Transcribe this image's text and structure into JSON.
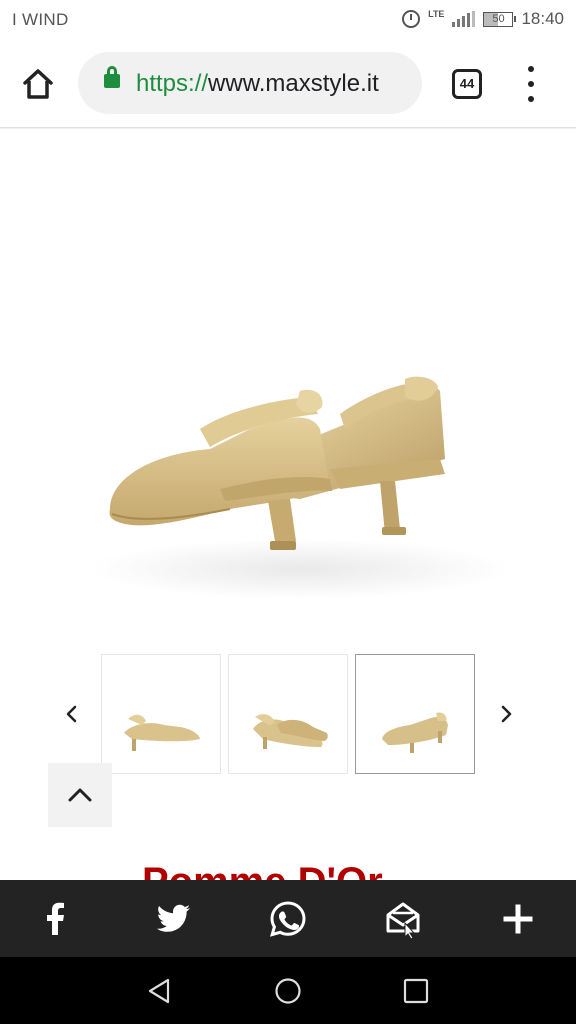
{
  "status_bar": {
    "carrier": "I WIND",
    "network": "LTE",
    "battery": "50",
    "time": "18:40"
  },
  "browser": {
    "url_scheme": "https://",
    "url_host": "www.maxstyle.it",
    "tab_count": "44",
    "icons": [
      "home-icon",
      "lock-icon",
      "tabs-icon",
      "more-vert-icon"
    ]
  },
  "product": {
    "image_alt": "gold slingback kitten heel shoes",
    "title_partial": "Pomme D'Or",
    "thumbnails": [
      "side-view",
      "pair-view",
      "back-view"
    ],
    "active_thumbnail_index": 2
  },
  "share_bar": {
    "icons": [
      "facebook-icon",
      "twitter-icon",
      "whatsapp-icon",
      "email-icon",
      "plus-icon"
    ]
  },
  "colors": {
    "title_red": "#b00000",
    "secure_green": "#1e8e3e",
    "share_bar_bg": "#232323",
    "shoe_gold": "#d8c28e"
  }
}
